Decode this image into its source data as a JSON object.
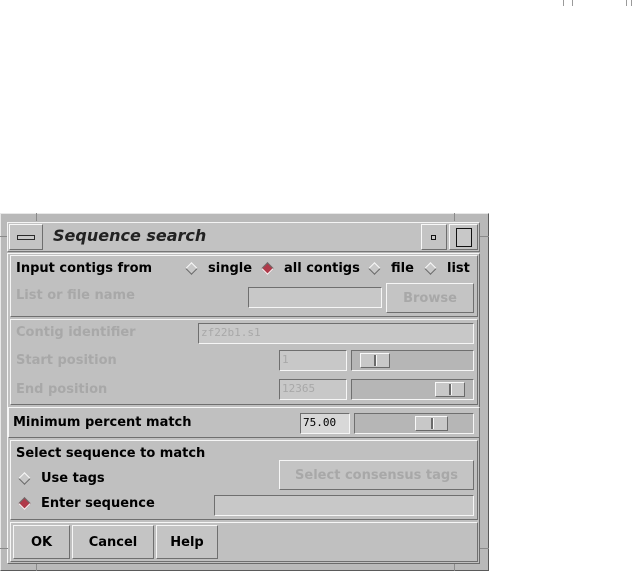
{
  "window": {
    "title": "Sequence search"
  },
  "input_contigs": {
    "label": "Input contigs from",
    "options": [
      "single",
      "all contigs",
      "file",
      "list"
    ],
    "selected": "all contigs"
  },
  "list_file": {
    "label": "List or file name",
    "value": "",
    "browse_label": "Browse"
  },
  "contig": {
    "label": "Contig identifier",
    "value": "zf22b1.s1"
  },
  "start": {
    "label": "Start position",
    "value": "1"
  },
  "end": {
    "label": "End position",
    "value": "12365"
  },
  "min_match": {
    "label": "Minimum percent match",
    "value": "75.00"
  },
  "select_seq": {
    "heading": "Select sequence to match",
    "use_tags": "Use tags",
    "enter_sequence": "Enter sequence",
    "selected": "Enter sequence",
    "consensus_button": "Select consensus tags",
    "sequence_value": ""
  },
  "footer": {
    "ok": "OK",
    "cancel": "Cancel",
    "help": "Help"
  },
  "colors": {
    "background": "#c0c0c0",
    "radio_selected": "#b03a4a",
    "disabled_text": "#a8a8a8"
  }
}
